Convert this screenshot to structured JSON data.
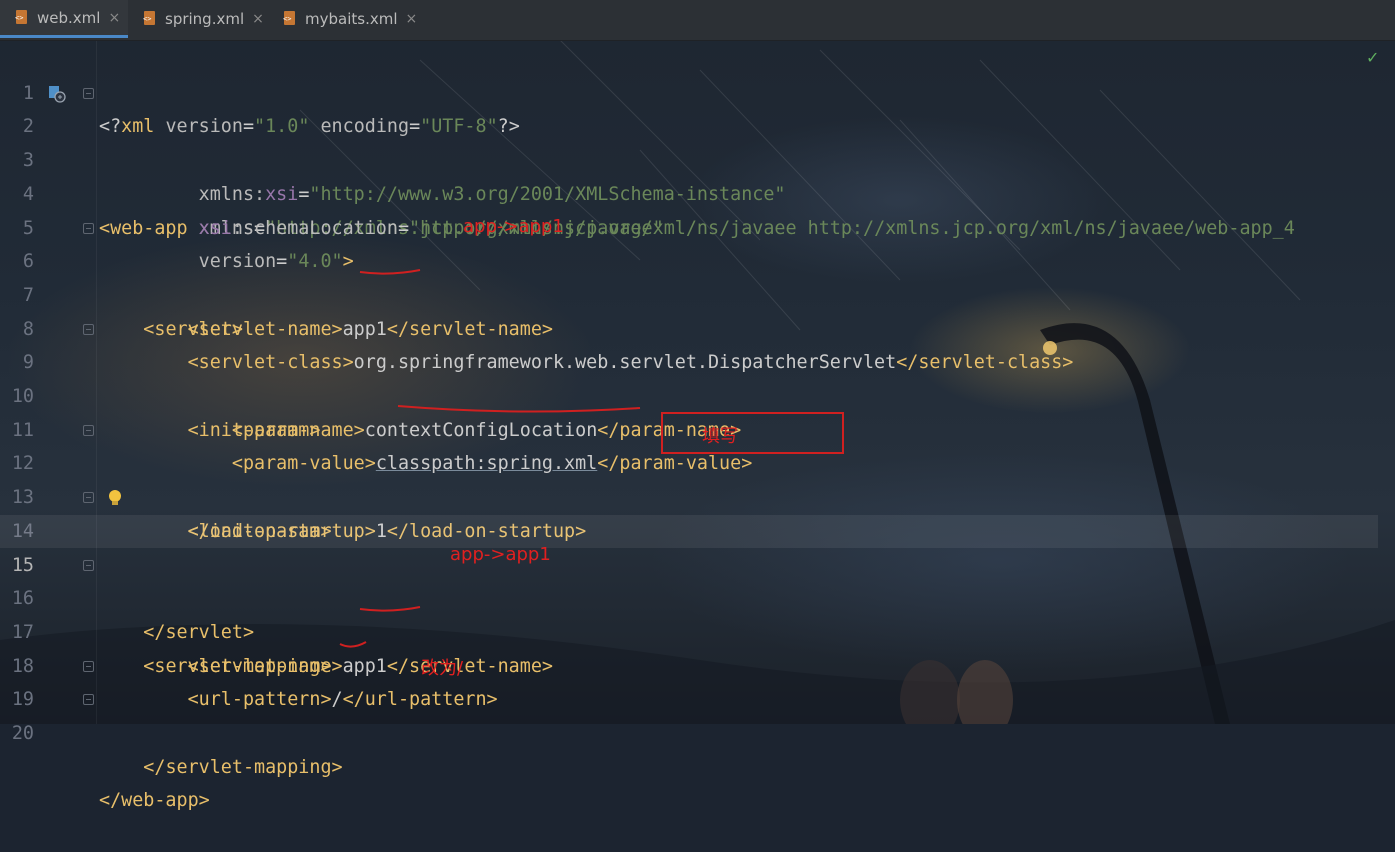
{
  "tabs": [
    {
      "label": "web.xml",
      "active": true
    },
    {
      "label": "spring.xml",
      "active": false
    },
    {
      "label": "mybaits.xml",
      "active": false
    }
  ],
  "tab_close_glyph": "×",
  "status_check": "✓",
  "lines": [
    {
      "num": "1"
    },
    {
      "num": "2"
    },
    {
      "num": "3"
    },
    {
      "num": "4"
    },
    {
      "num": "5"
    },
    {
      "num": "6"
    },
    {
      "num": "7"
    },
    {
      "num": "8"
    },
    {
      "num": "9"
    },
    {
      "num": "10"
    },
    {
      "num": "11"
    },
    {
      "num": "12"
    },
    {
      "num": "13"
    },
    {
      "num": "14"
    },
    {
      "num": "15"
    },
    {
      "num": "16"
    },
    {
      "num": "17"
    },
    {
      "num": "18"
    },
    {
      "num": "19"
    },
    {
      "num": "20"
    }
  ],
  "code": {
    "l1": {
      "open": "<?",
      "tag": "xml",
      "attr1": " version",
      "eq": "=",
      "val1": "\"1.0\"",
      "attr2": " encoding",
      "val2": "\"UTF-8\"",
      "close": "?>"
    },
    "l2": {
      "tag": "<web-app",
      "attr": " xmlns",
      "eq": "=",
      "val": "\"http://xmlns.jcp.org/xml/ns/javaee\""
    },
    "l3": {
      "indent": "         ",
      "attr": "xmlns:",
      "ns": "xsi",
      "eq": "=",
      "val": "\"http://www.w3.org/2001/XMLSchema-instance\""
    },
    "l4": {
      "indent": "         ",
      "ns": "xsi",
      "attr": ":schemaLocation",
      "eq": "=",
      "val": "\"http://xmlns.jcp.org/xml/ns/javaee http://xmlns.jcp.org/xml/ns/javaee/web-app_4"
    },
    "l5": {
      "indent": "         ",
      "attr": "version",
      "eq": "=",
      "val": "\"4.0\"",
      "close": ">"
    },
    "l6": {
      "indent": "    ",
      "tag": "<servlet>"
    },
    "l7": {
      "indent": "        ",
      "open": "<servlet-name>",
      "text": "app1",
      "close": "</servlet-name>"
    },
    "l8": {
      "indent": "        ",
      "open": "<servlet-class>",
      "text": "org.springframework.web.servlet.DispatcherServlet",
      "close": "</servlet-class>"
    },
    "l9": {
      "indent": "        ",
      "tag": "<init-param>"
    },
    "l10": {
      "indent": "            ",
      "open": "<param-name>",
      "text": "contextConfigLocation",
      "close": "</param-name>"
    },
    "l11": {
      "indent": "            ",
      "open": "<param-value>",
      "text": "classpath:spring.xml",
      "close": "</param-value>"
    },
    "l12": {
      "indent": "        ",
      "tag": "</init-param>"
    },
    "l13": {
      "indent": "        ",
      "open": "<load-on-startup>",
      "text": "1",
      "close": "</load-on-startup>"
    },
    "l14": {
      "indent": "    ",
      "tag": "</servlet>"
    },
    "l15": {
      "indent": ""
    },
    "l16": {
      "indent": "    ",
      "tag": "<servlet-mapping>"
    },
    "l17": {
      "indent": "        ",
      "open": "<servlet-name>",
      "text": "app1",
      "close": "</servlet-name>"
    },
    "l18": {
      "indent": "        ",
      "open": "<url-pattern>",
      "text": "/",
      "close": "</url-pattern>"
    },
    "l19": {
      "indent": "    ",
      "tag": "</servlet-mapping>"
    },
    "l20": {
      "indent": "",
      "tag": "</web-app>"
    }
  },
  "annotations": {
    "a1": "app->app1",
    "a2": "填写",
    "a3": "app->app1",
    "a4": "改为/"
  },
  "colors": {
    "tag": "#e8bf6a",
    "attribute": "#bababa",
    "value": "#6a8759",
    "namespace": "#9876aa",
    "annotation": "#e02020"
  }
}
